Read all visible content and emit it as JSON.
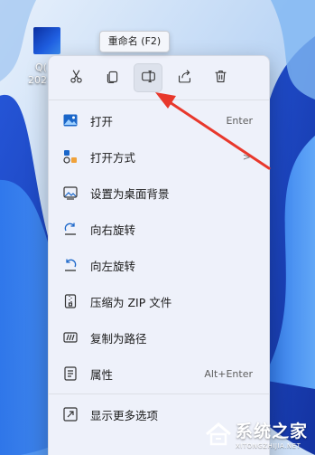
{
  "desktop": {
    "icon_line1": "Q(",
    "icon_line2": "202"
  },
  "tooltip": "重命名 (F2)",
  "toolbar": [
    {
      "name": "cut-button",
      "icon": "scissors-icon"
    },
    {
      "name": "copy-button",
      "icon": "copy-icon"
    },
    {
      "name": "rename-button",
      "icon": "rename-icon",
      "active": true
    },
    {
      "name": "share-button",
      "icon": "share-icon"
    },
    {
      "name": "delete-button",
      "icon": "trash-icon"
    }
  ],
  "menu_items": [
    {
      "label": "打开",
      "shortcut": "Enter",
      "icon": "image-icon"
    },
    {
      "label": "打开方式",
      "chevron": ">",
      "icon": "open-with-icon"
    },
    {
      "label": "设置为桌面背景",
      "icon": "wallpaper-icon"
    },
    {
      "label": "向右旋转",
      "icon": "rotate-right-icon"
    },
    {
      "label": "向左旋转",
      "icon": "rotate-left-icon"
    },
    {
      "label": "压缩为 ZIP 文件",
      "icon": "zip-icon"
    },
    {
      "label": "复制为路径",
      "icon": "copy-path-icon"
    },
    {
      "label": "属性",
      "shortcut": "Alt+Enter",
      "icon": "properties-icon"
    },
    {
      "label": "显示更多选项",
      "shortcut": "",
      "icon": "more-options-icon"
    }
  ],
  "watermark": {
    "main": "系统之家",
    "sub": "XITONGZHIJIA.NET"
  },
  "colors": {
    "arrow": "#e8382c",
    "icon_blue": "#1a66c9"
  }
}
